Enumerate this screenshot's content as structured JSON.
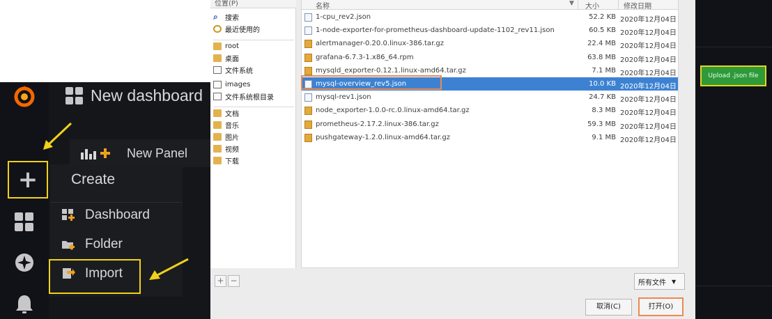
{
  "grafana": {
    "title": "New dashboard",
    "new_panel_label": "New Panel",
    "menu": {
      "heading": "Create",
      "items": [
        {
          "label": "Dashboard",
          "icon": "dashboard-plus-icon"
        },
        {
          "label": "Folder",
          "icon": "folder-plus-icon"
        },
        {
          "label": "Import",
          "icon": "import-icon"
        }
      ]
    },
    "colors": {
      "highlight": "#f0d21a",
      "sidebar": "#111217",
      "panel": "#141619",
      "text": "#d8d9da"
    }
  },
  "file_chooser": {
    "places_header": "位置(P)",
    "places": [
      {
        "label": "搜索",
        "icon": "search-icon"
      },
      {
        "label": "最近使用的",
        "icon": "recent-icon"
      },
      {
        "label": "root",
        "icon": "folder-icon"
      },
      {
        "label": "桌面",
        "icon": "folder-icon"
      },
      {
        "label": "文件系统",
        "icon": "drive-icon"
      },
      {
        "label": "images",
        "icon": "drive-icon"
      },
      {
        "label": "文件系统根目录",
        "icon": "drive-icon"
      },
      {
        "label": "文档",
        "icon": "folder-icon"
      },
      {
        "label": "音乐",
        "icon": "folder-icon"
      },
      {
        "label": "图片",
        "icon": "folder-icon"
      },
      {
        "label": "视频",
        "icon": "folder-icon"
      },
      {
        "label": "下载",
        "icon": "folder-icon"
      }
    ],
    "columns": {
      "name": "名称",
      "size": "大小",
      "modified": "修改日期"
    },
    "files": [
      {
        "name": "1-cpu_rev2.json",
        "size": "52.2 KB",
        "date": "2020年12月04日",
        "type": "json"
      },
      {
        "name": "1-node-exporter-for-prometheus-dashboard-update-1102_rev11.json",
        "size": "60.5 KB",
        "date": "2020年12月04日",
        "type": "json"
      },
      {
        "name": "alertmanager-0.20.0.linux-386.tar.gz",
        "size": "22.4 MB",
        "date": "2020年12月04日",
        "type": "gz"
      },
      {
        "name": "grafana-6.7.3-1.x86_64.rpm",
        "size": "63.8 MB",
        "date": "2020年12月04日",
        "type": "gz"
      },
      {
        "name": "mysqld_exporter-0.12.1.linux-amd64.tar.gz",
        "size": "7.1 MB",
        "date": "2020年12月04日",
        "type": "gz"
      },
      {
        "name": "mysql-overview_rev5.json",
        "size": "10.0 KB",
        "date": "2020年12月04日",
        "type": "json"
      },
      {
        "name": "mysql-rev1.json",
        "size": "24.7 KB",
        "date": "2020年12月04日",
        "type": "json"
      },
      {
        "name": "node_exporter-1.0.0-rc.0.linux-amd64.tar.gz",
        "size": "8.3 MB",
        "date": "2020年12月04日",
        "type": "gz"
      },
      {
        "name": "prometheus-2.17.2.linux-386.tar.gz",
        "size": "59.3 MB",
        "date": "2020年12月04日",
        "type": "gz"
      },
      {
        "name": "pushgateway-1.2.0.linux-amd64.tar.gz",
        "size": "9.1 MB",
        "date": "2020年12月04日",
        "type": "gz"
      }
    ],
    "selected_file": "mysql-overview_rev5.json",
    "filter_label": "所有文件",
    "cancel_label": "取消(C)",
    "open_label": "打开(O)",
    "colors": {
      "selection": "#3d82d2",
      "highlight_box": "#ea8a52"
    }
  },
  "right_panel": {
    "upload_label": "Upload .json file",
    "colors": {
      "button": "#2e9a3a",
      "highlight": "#e6d51e"
    }
  }
}
